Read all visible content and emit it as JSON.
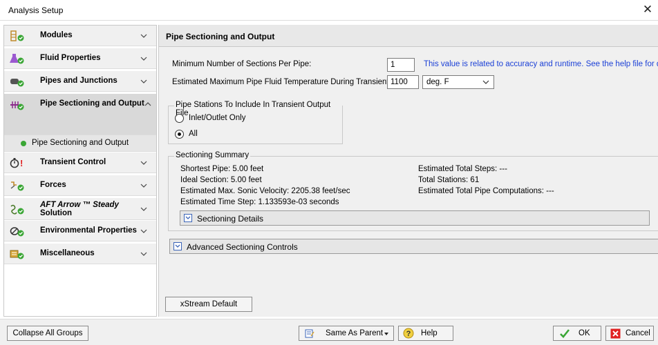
{
  "window": {
    "title": "Analysis Setup",
    "close_label": "✕"
  },
  "sidebar": {
    "groups": [
      {
        "label": "Modules",
        "icon": "modules-icon",
        "status": "ok"
      },
      {
        "label": "Fluid Properties",
        "icon": "flask-icon",
        "status": "ok"
      },
      {
        "label": "Pipes and Junctions",
        "icon": "pipe-icon",
        "status": "ok"
      },
      {
        "label": "Pipe Sectioning and Output",
        "icon": "sectioning-icon",
        "status": "ok",
        "expanded": true
      },
      {
        "label": "Transient Control",
        "icon": "stopwatch-icon",
        "status": "error"
      },
      {
        "label": "Forces",
        "icon": "forces-icon",
        "status": "ok"
      },
      {
        "label": "AFT Arrow ™ Steady Solution",
        "label_line1": "AFT Arrow ™ Steady",
        "label_line2": "Solution",
        "icon": "steady-solution-icon",
        "status": "ok"
      },
      {
        "label": "Environmental Properties",
        "icon": "environment-icon",
        "status": "ok"
      },
      {
        "label": "Miscellaneous",
        "icon": "miscellaneous-icon",
        "status": "ok"
      }
    ],
    "active_subitem": "Pipe Sectioning and Output"
  },
  "panel": {
    "title": "Pipe Sectioning and Output",
    "min_sections_label": "Minimum Number of Sections Per Pipe:",
    "min_sections_value": "1",
    "min_sections_hint": "This value is related to accuracy and runtime. See the help file for details.",
    "max_temp_label": "Estimated Maximum Pipe Fluid Temperature During Transient:",
    "max_temp_value": "1100",
    "max_temp_unit": "deg. F",
    "stations_group": {
      "legend": "Pipe Stations To Include In Transient Output File",
      "options": [
        {
          "label": "Inlet/Outlet Only",
          "selected": false
        },
        {
          "label": "All",
          "selected": true
        }
      ]
    },
    "summary": {
      "legend": "Sectioning Summary",
      "left": [
        "Shortest Pipe: 5.00 feet",
        "Ideal Section: 5.00 feet",
        "Estimated Max. Sonic Velocity: 2205.38 feet/sec",
        "Estimated Time Step: 1.133593e-03 seconds"
      ],
      "right": [
        "Estimated Total Steps: ---",
        "Total Stations: 61",
        "Estimated Total Pipe Computations: ---"
      ],
      "details_label": "Sectioning Details"
    },
    "advanced_label": "Advanced Sectioning Controls",
    "xstream_button": "xStream Default"
  },
  "footer": {
    "collapse_all": "Collapse All Groups",
    "same_as_parent": "Same As Parent",
    "help": "Help",
    "ok": "OK",
    "cancel": "Cancel"
  },
  "colors": {
    "ok_green": "#3aa635",
    "error_red": "#e02020",
    "hint_blue": "#1a3fd6"
  }
}
